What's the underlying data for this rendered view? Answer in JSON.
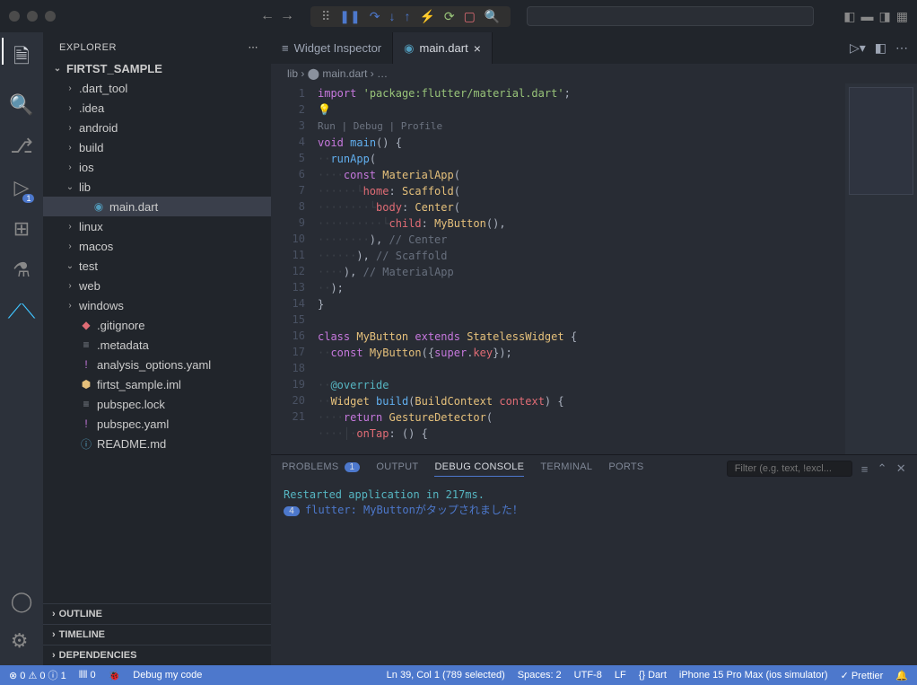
{
  "sidebar": {
    "title": "EXPLORER",
    "root": "FIRTST_SAMPLE",
    "tree": [
      {
        "label": ".dart_tool",
        "type": "folder",
        "expanded": false,
        "indent": 1
      },
      {
        "label": ".idea",
        "type": "folder",
        "expanded": false,
        "indent": 1
      },
      {
        "label": "android",
        "type": "folder",
        "expanded": false,
        "indent": 1
      },
      {
        "label": "build",
        "type": "folder",
        "expanded": false,
        "indent": 1
      },
      {
        "label": "ios",
        "type": "folder",
        "expanded": false,
        "indent": 1
      },
      {
        "label": "lib",
        "type": "folder",
        "expanded": true,
        "indent": 1
      },
      {
        "label": "main.dart",
        "type": "file",
        "icon": "dart",
        "indent": 2,
        "active": true
      },
      {
        "label": "linux",
        "type": "folder",
        "expanded": false,
        "indent": 1
      },
      {
        "label": "macos",
        "type": "folder",
        "expanded": false,
        "indent": 1
      },
      {
        "label": "test",
        "type": "folder",
        "expanded": true,
        "indent": 1
      },
      {
        "label": "web",
        "type": "folder",
        "expanded": false,
        "indent": 1
      },
      {
        "label": "windows",
        "type": "folder",
        "expanded": false,
        "indent": 1
      },
      {
        "label": ".gitignore",
        "type": "file",
        "icon": "git",
        "indent": 1
      },
      {
        "label": ".metadata",
        "type": "file",
        "icon": "gray",
        "indent": 1
      },
      {
        "label": "analysis_options.yaml",
        "type": "file",
        "icon": "yaml",
        "indent": 1
      },
      {
        "label": "firtst_sample.iml",
        "type": "file",
        "icon": "iml",
        "indent": 1
      },
      {
        "label": "pubspec.lock",
        "type": "file",
        "icon": "gray",
        "indent": 1
      },
      {
        "label": "pubspec.yaml",
        "type": "file",
        "icon": "yaml",
        "indent": 1
      },
      {
        "label": "README.md",
        "type": "file",
        "icon": "readme",
        "indent": 1
      }
    ],
    "sections": [
      "OUTLINE",
      "TIMELINE",
      "DEPENDENCIES"
    ]
  },
  "tabs": [
    {
      "label": "Widget Inspector",
      "icon": "≡",
      "active": false
    },
    {
      "label": "main.dart",
      "icon": "dart",
      "active": true,
      "closeable": true
    }
  ],
  "breadcrumbs": "lib › ⬤ main.dart › …",
  "codelens": "Run | Debug | Profile",
  "code_lines": [
    {
      "n": 1,
      "html": "<span class='kw'>import</span> <span class='str'>'package:flutter/material.dart'</span><span class='punc'>;</span>"
    },
    {
      "n": 2,
      "html": "<span class='bulb'>💡</span>"
    },
    {
      "n": "",
      "html": "<span class='codelens'>Run | Debug | Profile</span>",
      "codelens": true
    },
    {
      "n": 3,
      "html": "<span class='kw'>void</span> <span class='fn'>main</span>() <span class='punc'>{</span>"
    },
    {
      "n": 4,
      "html": "<span class='indent'>··</span><span class='fn'>runApp</span>("
    },
    {
      "n": 5,
      "html": "<span class='indent'>····</span><span class='kw'>const</span> <span class='cls'>MaterialApp</span>("
    },
    {
      "n": 6,
      "html": "<span class='indent'>······└</span><span class='prop'>home</span>: <span class='cls'>Scaffold</span>("
    },
    {
      "n": 7,
      "html": "<span class='indent'>········└</span><span class='prop'>body</span>: <span class='cls'>Center</span>("
    },
    {
      "n": 8,
      "html": "<span class='indent'>··········└</span><span class='prop'>child</span>: <span class='cls'>MyButton</span>()<span class='punc'>,</span>"
    },
    {
      "n": 9,
      "html": "<span class='indent'>········</span>), <span class='cmt'>// Center</span>"
    },
    {
      "n": 10,
      "html": "<span class='indent'>······</span>), <span class='cmt'>// Scaffold</span>"
    },
    {
      "n": 11,
      "html": "<span class='indent'>····</span>), <span class='cmt'>// MaterialApp</span>"
    },
    {
      "n": 12,
      "html": "<span class='indent'>··</span>);"
    },
    {
      "n": 13,
      "html": "<span class='punc'>}</span>"
    },
    {
      "n": 14,
      "html": ""
    },
    {
      "n": 15,
      "html": "<span class='kw'>class</span> <span class='cls'>MyButton</span> <span class='kw'>extends</span> <span class='cls'>StatelessWidget</span> <span class='punc'>{</span>"
    },
    {
      "n": 16,
      "html": "<span class='indent'>··</span><span class='kw'>const</span> <span class='cls'>MyButton</span>({<span class='kw'>super</span>.<span class='prop'>key</span>});"
    },
    {
      "n": 17,
      "html": ""
    },
    {
      "n": 18,
      "html": "<span class='indent'>··</span><span class='at'>@override</span>"
    },
    {
      "n": 19,
      "html": "<span class='indent'>··</span><span class='cls'>Widget</span> <span class='fn'>build</span>(<span class='cls'>BuildContext</span> <span class='prop'>context</span>) <span class='punc'>{</span>"
    },
    {
      "n": 20,
      "html": "<span class='indent'>····</span><span class='kw'>return</span> <span class='cls'>GestureDetector</span>("
    },
    {
      "n": 21,
      "html": "<span class='indent'>····│·</span><span class='prop'>onTap</span>: () {"
    }
  ],
  "panel": {
    "tabs": [
      {
        "label": "PROBLEMS",
        "badge": "1"
      },
      {
        "label": "OUTPUT"
      },
      {
        "label": "DEBUG CONSOLE",
        "active": true
      },
      {
        "label": "TERMINAL"
      },
      {
        "label": "PORTS"
      }
    ],
    "filter_placeholder": "Filter (e.g. text, !excl...",
    "console": [
      {
        "cls": "l1",
        "text": "Restarted application in 217ms."
      },
      {
        "cls": "l2",
        "count": "4",
        "text": "flutter: MyButtonがタップされました！"
      }
    ]
  },
  "status": {
    "left": [
      "⊗ 0 ⚠ 0 ⓘ 1",
      "⦀⦀ 0",
      "🐞",
      "Debug my code"
    ],
    "right": [
      "Ln 39, Col 1 (789 selected)",
      "Spaces: 2",
      "UTF-8",
      "LF",
      "{} Dart",
      "iPhone 15 Pro Max (ios simulator)",
      "✓ Prettier",
      "🔔"
    ]
  }
}
